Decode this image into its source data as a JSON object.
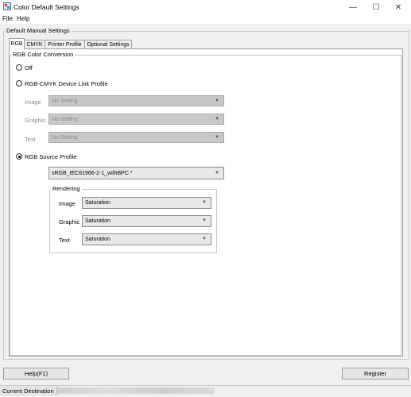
{
  "window": {
    "title": "Color Default Settings",
    "minimize": "—",
    "maximize": "☐",
    "close": "✕"
  },
  "menu": {
    "file": "File",
    "help": "Help"
  },
  "group": {
    "title": "Default Manual Settings"
  },
  "tabs": [
    {
      "label": "RGB"
    },
    {
      "label": "CMYK"
    },
    {
      "label": "Printer Profile"
    },
    {
      "label": "Optional Settings"
    }
  ],
  "conversion": {
    "title": "RGB Color Conversion",
    "off_label": "Off",
    "device_link_label": "RGB-CMYK Device Link Profile",
    "device_link": {
      "image_label": "Image",
      "image_value": "No Setting",
      "graphic_label": "Graphic",
      "graphic_value": "No Setting",
      "text_label": "Text",
      "text_value": "No Setting"
    },
    "source_profile_label": "RGB Source Profile",
    "source_profile_value": "sRGB_IEC61966-2-1_withBPC  *",
    "rendering": {
      "title": "Rendering",
      "image_label": "Image",
      "image_value": "Saturation",
      "graphic_label": "Graphic",
      "graphic_value": "Saturation",
      "text_label": "Text",
      "text_value": "Saturation"
    },
    "selected": "source_profile"
  },
  "buttons": {
    "help": "Help(F1)",
    "register": "Register"
  },
  "status": {
    "label": "Current Destination"
  }
}
